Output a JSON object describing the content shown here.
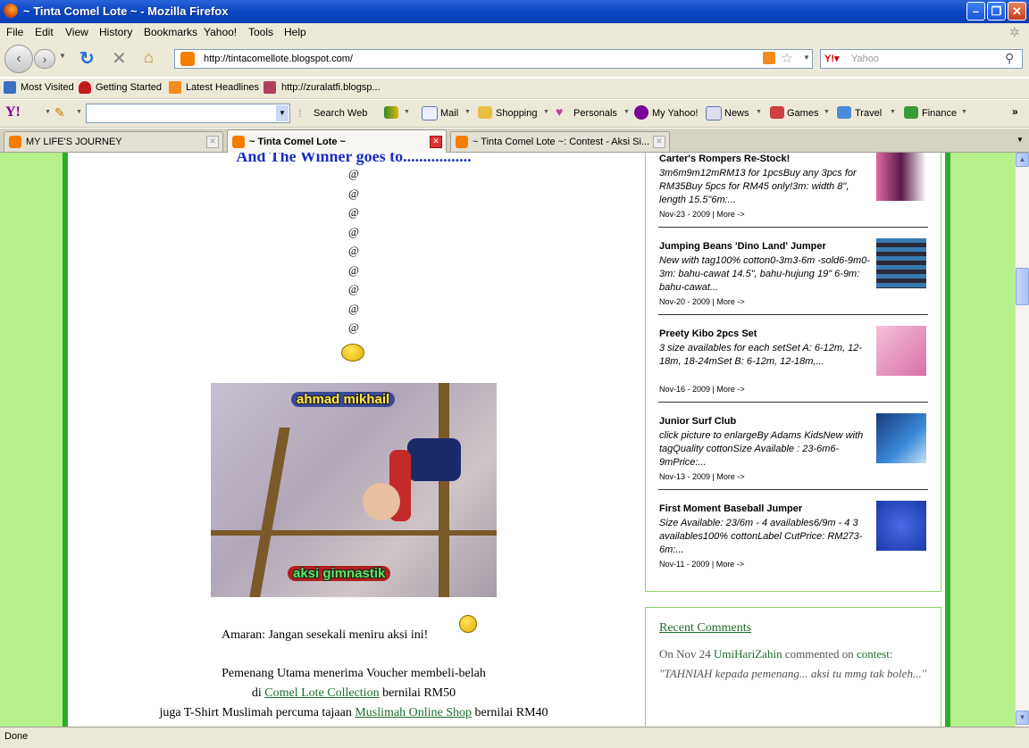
{
  "window": {
    "title": "~ Tinta Comel Lote ~ - Mozilla Firefox"
  },
  "menu": {
    "file": "File",
    "edit": "Edit",
    "view": "View",
    "history": "History",
    "bookmarks": "Bookmarks",
    "yahoo": "Yahoo!",
    "tools": "Tools",
    "help": "Help"
  },
  "nav": {
    "url": "http://tintacomellote.blogspot.com/",
    "search_placeholder": "Yahoo"
  },
  "bookmarks": {
    "most_visited": "Most Visited",
    "getting_started": "Getting Started",
    "latest_headlines": "Latest Headlines",
    "zuralatfi": "http://zuralatfi.blogsp..."
  },
  "yahoo_toolbar": {
    "search_web": "Search Web",
    "mail": "Mail",
    "shopping": "Shopping",
    "personals": "Personals",
    "my_yahoo": "My Yahoo!",
    "news": "News",
    "games": "Games",
    "travel": "Travel",
    "finance": "Finance"
  },
  "tabs": [
    {
      "label": "MY LIFE'S JOURNEY"
    },
    {
      "label": "~ Tinta Comel Lote ~"
    },
    {
      "label": "~ Tinta Comel Lote ~: Contest - Aksi Si..."
    }
  ],
  "post": {
    "heading": "And The Winner goes to.................",
    "at_sign": "@",
    "photo_top": "ahmad mikhail",
    "photo_bottom": "aksi gimnastik",
    "warning": "Amaran: Jangan sesekali meniru aksi ini!",
    "line1": "Pemenang Utama menerima Voucher membeli-belah",
    "line2_pre": "di ",
    "line2_link": "Comel Lote Collection",
    "line2_post": " bernilai RM50",
    "line3_pre": "juga T-Shirt Muslimah percuma tajaan ",
    "line3_link": "Muslimah Online Shop",
    "line3_post": " bernilai RM40"
  },
  "sidebar": {
    "items": [
      {
        "title": "Carter's Rompers Re-Stock!",
        "desc": "3m6m9m12mRM13 for 1pcsBuy any 3pcs for RM35Buy 5pcs for RM45 only!3m: width 8\", length 15.5\"6m:...",
        "meta": "Nov-23 - 2009 | More ->"
      },
      {
        "title": "Jumping Beans 'Dino Land' Jumper",
        "desc": "New with tag100% cotton0-3m3-6m -sold6-9m0-3m: bahu-cawat 14.5\", bahu-hujung 19\" 6-9m: bahu-cawat...",
        "meta": "Nov-20 - 2009 | More ->"
      },
      {
        "title": "Preety Kibo 2pcs Set",
        "desc": "3 size availables for each setSet A: 6-12m, 12-18m, 18-24mSet B: 6-12m, 12-18m,...",
        "meta": "Nov-16 - 2009 | More ->"
      },
      {
        "title": "Junior Surf Club",
        "desc": "click picture to enlargeBy Adams KidsNew with tagQuality cottonSize Available : 23-6m6-9mPrice:...",
        "meta": "Nov-13 - 2009 | More ->"
      },
      {
        "title": "First Moment Baseball Jumper",
        "desc": "Size Available: 23/6m - 4 availables6/9m - 4 3 availables100% cottonLabel CutPrice: RM273-6m:...",
        "meta": "Nov-11 - 2009 | More ->"
      }
    ],
    "recent_title": "Recent Comments",
    "comment_pre": "On Nov 24 ",
    "comment_author": "UmiHariZahin",
    "comment_mid": " commented on ",
    "comment_post": "contest",
    "comment_colon": ":",
    "comment_text": "\"TAHNIAH kepada pemenang... aksi tu mmg tak boleh...\""
  },
  "status": {
    "text": "Done"
  }
}
